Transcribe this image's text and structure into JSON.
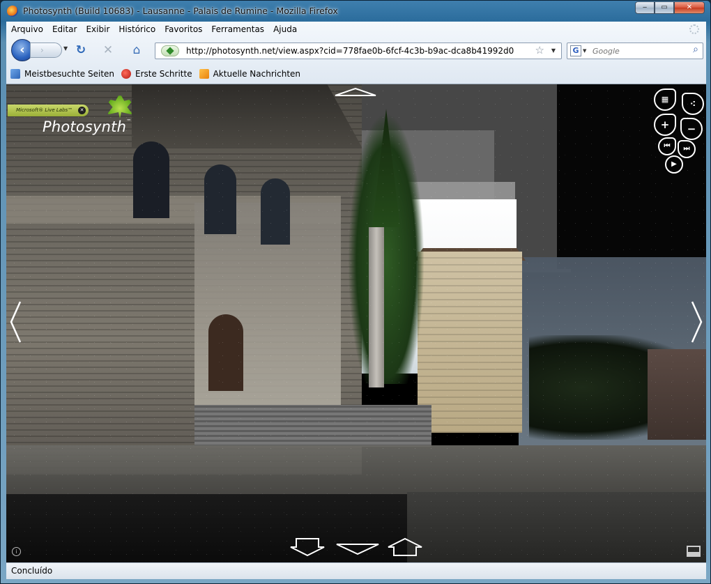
{
  "window": {
    "title": "Photosynth (Build 10683) - Lausanne - Palais de Rumine - Mozilla Firefox",
    "minimize_icon": "minimize-icon",
    "maximize_icon": "maximize-icon",
    "close_icon": "close-icon"
  },
  "menu": [
    "Arquivo",
    "Editar",
    "Exibir",
    "Histórico",
    "Favoritos",
    "Ferramentas",
    "Ajuda"
  ],
  "navigation": {
    "url": "http://photosynth.net/view.aspx?cid=778fae0b-6fcf-4c3b-b9ac-dca8b41992d0",
    "search_placeholder": "Google",
    "search_engine": "G"
  },
  "bookmarks": [
    {
      "label": "Meistbesuchte Seiten",
      "icon": "most-visited-icon"
    },
    {
      "label": "Erste Schritte",
      "icon": "getting-started-icon"
    },
    {
      "label": "Aktuelle Nachrichten",
      "icon": "rss-feed-icon"
    }
  ],
  "photosynth": {
    "badge": "Microsoft® Live Labs™",
    "name": "Photosynth",
    "trademark": "™"
  },
  "status": {
    "text": "Concluído"
  }
}
